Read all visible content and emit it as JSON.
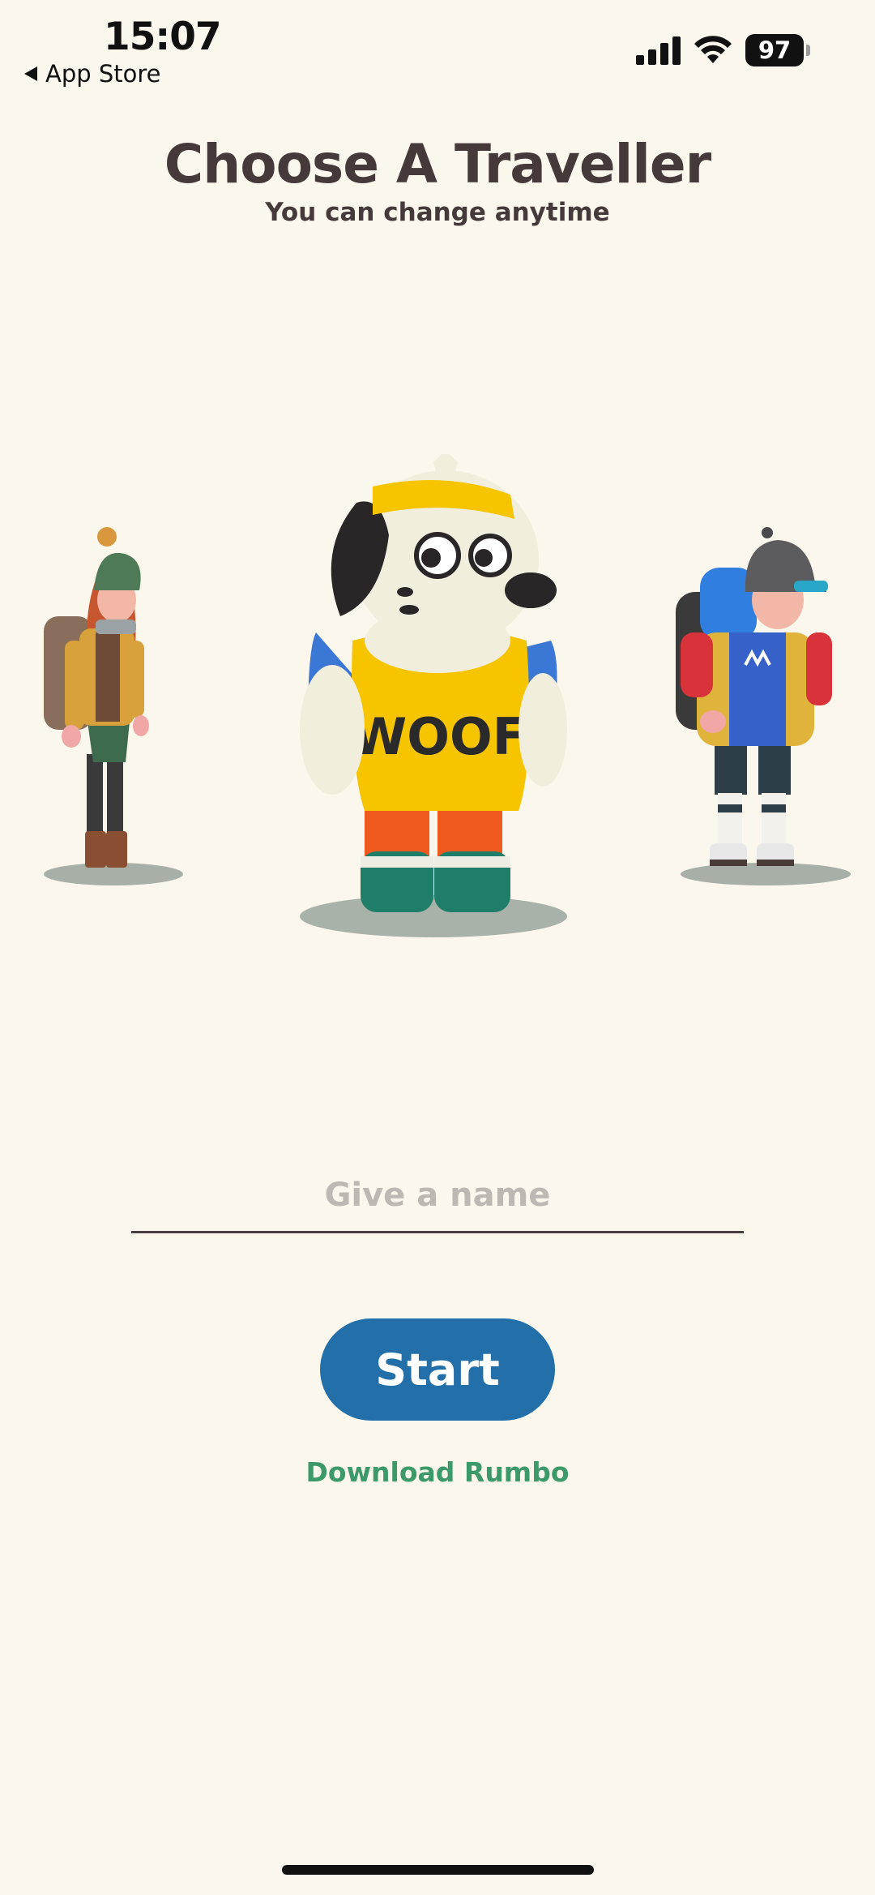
{
  "status_bar": {
    "time": "15:07",
    "back_label": "App Store",
    "battery": "97"
  },
  "header": {
    "title": "Choose A Traveller",
    "subtitle": "You can change anytime"
  },
  "characters": [
    {
      "name": "traveller-girl"
    },
    {
      "name": "traveller-dog",
      "shirt_text": "WOOF"
    },
    {
      "name": "traveller-boy"
    }
  ],
  "form": {
    "name_placeholder": "Give a name",
    "name_value": "",
    "start_label": "Start",
    "download_label": "Download Rumbo"
  },
  "colors": {
    "background": "#FBF7EC",
    "title": "#46393A",
    "start_button": "#226FAA",
    "download_link": "#3C9A6A"
  }
}
